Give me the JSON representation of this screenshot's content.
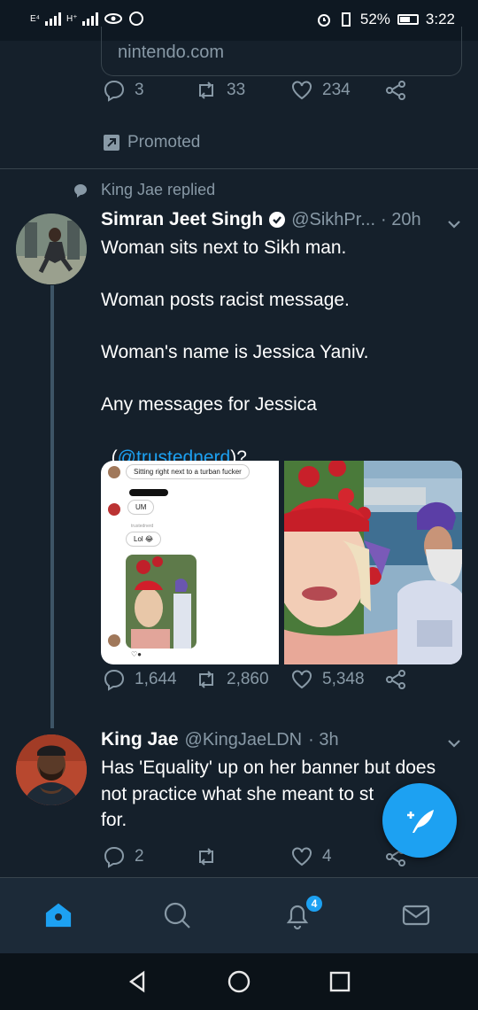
{
  "status_bar": {
    "carrier_left": "E⁴",
    "carrier_right": "H⁺",
    "battery": "52%",
    "time": "3:22"
  },
  "prev_tweet": {
    "link_domain": "nintendo.com",
    "replies": "3",
    "retweets": "33",
    "likes": "234",
    "promoted_label": "Promoted"
  },
  "reply_context": "King Jae replied",
  "tweet1": {
    "name": "Simran Jeet Singh",
    "handle": "@SikhPr...",
    "time": "· 20h",
    "line1": "Woman sits next to Sikh man.",
    "line2": "Woman posts racist message.",
    "line3": "Woman's name is Jessica Yaniv.",
    "line4": "Any messages for Jessica",
    "line5_open": "(",
    "mention": "@trustednerd",
    "line5_close": ")?",
    "media_left": {
      "bubble1": "Sitting right next to a turban fucker",
      "bubble2": "UM",
      "small_name": "trustednerd",
      "bubble3": "Lol 😂"
    },
    "replies": "1,644",
    "retweets": "2,860",
    "likes": "5,348"
  },
  "tweet2": {
    "name": "King Jae",
    "handle": "@KingJaeLDN",
    "time": "· 3h",
    "text": "Has 'Equality' up on her banner but does not practice what she meant to st for.",
    "line1": "Has 'Equality' up on her banner but does",
    "line2": "not practice what she meant to st",
    "line3": "for.",
    "replies": "2",
    "likes": "4"
  },
  "bottom_nav": {
    "notification_count": "4"
  },
  "colors": {
    "background": "#15202b",
    "accent": "#1da1f2",
    "muted": "#8899a6"
  }
}
